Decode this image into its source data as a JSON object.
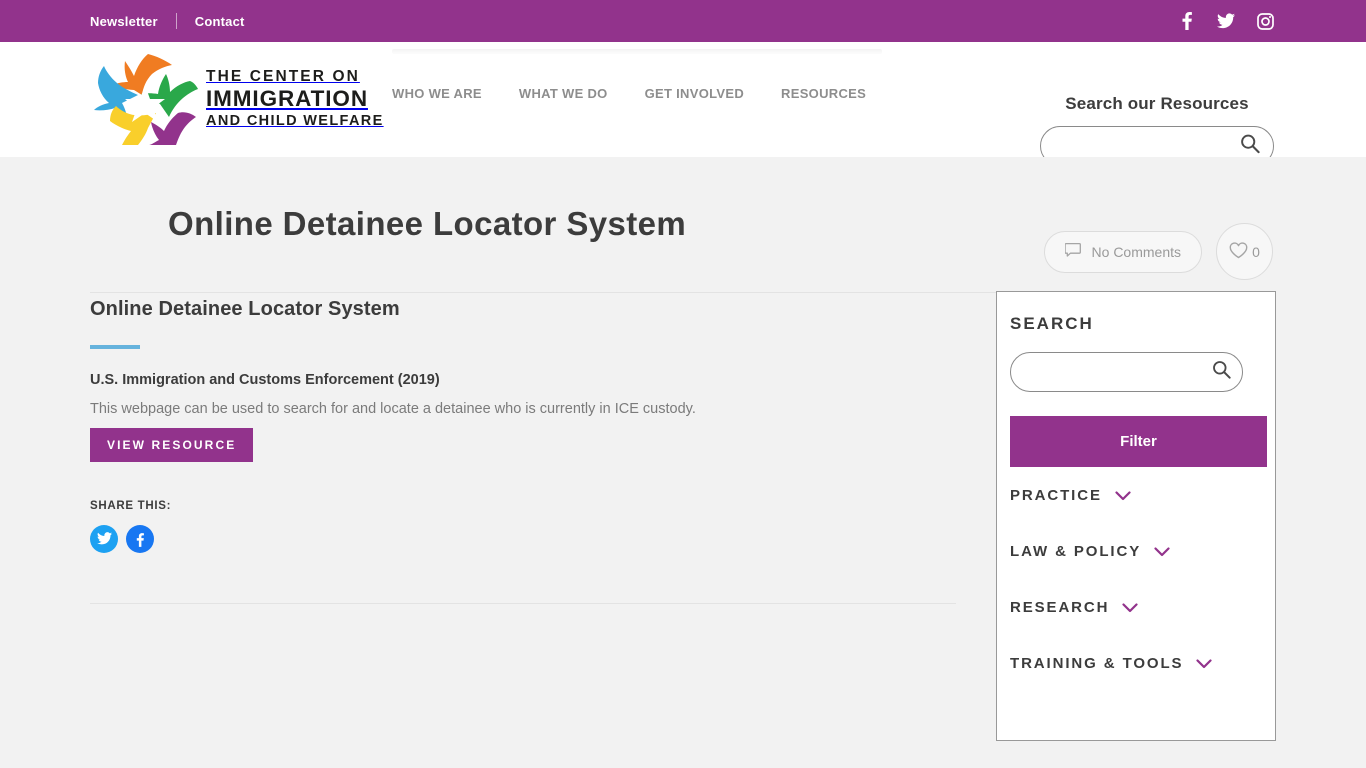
{
  "topbar": {
    "links": [
      {
        "label": "Newsletter"
      },
      {
        "label": "Contact"
      }
    ],
    "social": [
      {
        "name": "facebook-icon",
        "label": "Facebook"
      },
      {
        "name": "twitter-icon",
        "label": "Twitter"
      },
      {
        "name": "instagram-icon",
        "label": "Instagram"
      }
    ],
    "background_color": "#92338c"
  },
  "header": {
    "logo": {
      "line1": "THE CENTER ON",
      "line2": "IMMIGRATION",
      "line3": "AND CHILD WELFARE",
      "bird_colors": [
        "#f07c22",
        "#39a8dd",
        "#2aa84a",
        "#f9cf2b",
        "#92338c"
      ]
    },
    "nav": [
      {
        "label": "WHO WE ARE"
      },
      {
        "label": "WHAT WE DO"
      },
      {
        "label": "GET INVOLVED"
      },
      {
        "label": "RESOURCES"
      }
    ],
    "search": {
      "label": "Search our Resources",
      "value": "",
      "placeholder": ""
    }
  },
  "page": {
    "title": "Online Detainee Locator System",
    "comments_badge": "No Comments",
    "likes_count": "0"
  },
  "article": {
    "heading": "Online Detainee Locator System",
    "source": "U.S. Immigration and Customs Enforcement (2019)",
    "description": "This webpage can be used to search for and locate a detainee who is currently in ICE custody.",
    "resource_button": "VIEW RESOURCE",
    "accent_color": "#66b3dd",
    "share_label": "SHARE THIS:",
    "share": [
      {
        "name": "twitter-share-icon",
        "label": "Twitter",
        "color": "#1da1f2"
      },
      {
        "name": "facebook-share-icon",
        "label": "Facebook",
        "color": "#1877f2"
      }
    ]
  },
  "sidebar": {
    "title": "SEARCH",
    "search": {
      "value": "",
      "placeholder": ""
    },
    "filter_button": "Filter",
    "filter_button_color": "#92338c",
    "filters": [
      {
        "label": "PRACTICE"
      },
      {
        "label": "LAW & POLICY"
      },
      {
        "label": "RESEARCH"
      },
      {
        "label": "TRAINING & TOOLS"
      }
    ]
  }
}
